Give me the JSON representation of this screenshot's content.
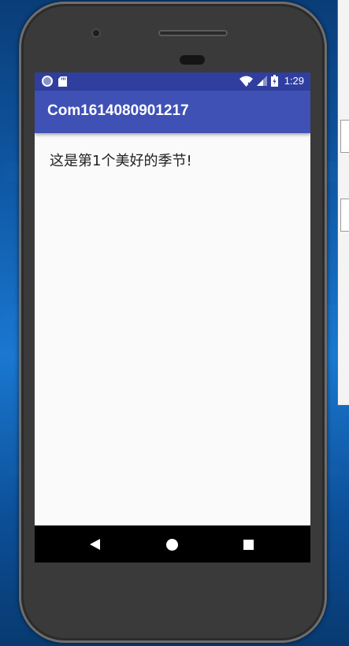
{
  "status_bar": {
    "time": "1:29",
    "left_icons": [
      "circle-icon",
      "sd-card-icon"
    ],
    "right_icons": [
      "wifi-icon",
      "signal-icon",
      "battery-icon"
    ]
  },
  "app_bar": {
    "title": "Com1614080901217"
  },
  "content": {
    "text": "这是第1个美好的季节!"
  },
  "nav_bar": {
    "icons": [
      "back-icon",
      "home-icon",
      "recents-icon"
    ]
  },
  "colors": {
    "status_bar": "#303f9f",
    "app_bar": "#3f51b5",
    "screen_background": "#fafafa",
    "nav_bar": "#000000"
  }
}
